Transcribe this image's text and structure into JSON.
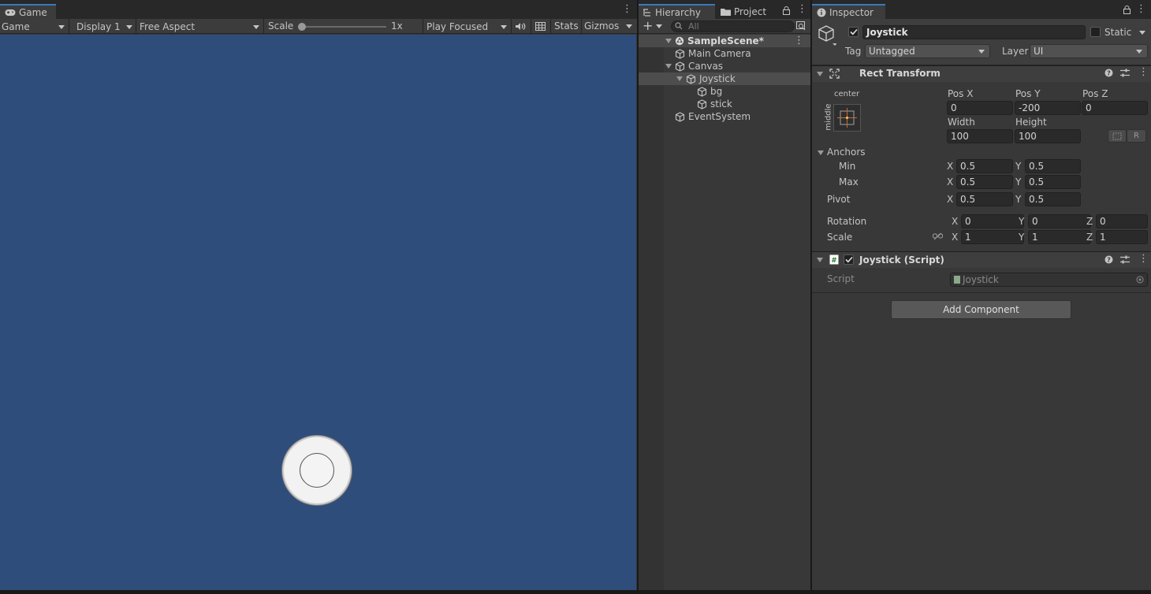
{
  "game": {
    "tab_label": "Game",
    "toolbar": {
      "mode": "Game",
      "display": "Display 1",
      "aspect": "Free Aspect",
      "scale_label": "Scale",
      "scale_value": "1x",
      "play_mode": "Play Focused",
      "stats": "Stats",
      "gizmos": "Gizmos"
    },
    "background_color": "#2f4d7a"
  },
  "hierarchy": {
    "tab_label": "Hierarchy",
    "project_tab_label": "Project",
    "search_placeholder": "All",
    "scene_name": "SampleScene*",
    "items": [
      {
        "label": "Main Camera",
        "depth": 1,
        "selected": false
      },
      {
        "label": "Canvas",
        "depth": 1,
        "selected": false
      },
      {
        "label": "Joystick",
        "depth": 2,
        "selected": true
      },
      {
        "label": "bg",
        "depth": 3,
        "selected": false
      },
      {
        "label": "stick",
        "depth": 3,
        "selected": false
      },
      {
        "label": "EventSystem",
        "depth": 1,
        "selected": false
      }
    ]
  },
  "inspector": {
    "tab_label": "Inspector",
    "object_name": "Joystick",
    "static_label": "Static",
    "tag_label": "Tag",
    "tag_value": "Untagged",
    "layer_label": "Layer",
    "layer_value": "UI",
    "rect_transform": {
      "title": "Rect Transform",
      "anchor_h": "center",
      "anchor_v": "middle",
      "posx_label": "Pos X",
      "posy_label": "Pos Y",
      "posz_label": "Pos Z",
      "posx": "0",
      "posy": "-200",
      "posz": "0",
      "width_label": "Width",
      "height_label": "Height",
      "width": "100",
      "height": "100",
      "r_button": "R",
      "anchors_label": "Anchors",
      "min_label": "Min",
      "max_label": "Max",
      "min_x": "0.5",
      "min_y": "0.5",
      "max_x": "0.5",
      "max_y": "0.5",
      "pivot_label": "Pivot",
      "pivot_x": "0.5",
      "pivot_y": "0.5",
      "rotation_label": "Rotation",
      "rot_x": "0",
      "rot_y": "0",
      "rot_z": "0",
      "scale_label": "Scale",
      "scale_x": "1",
      "scale_y": "1",
      "scale_z": "1",
      "x": "X",
      "y": "Y",
      "z": "Z"
    },
    "script_component": {
      "title": "Joystick (Script)",
      "script_label": "Script",
      "script_value": "Joystick"
    },
    "add_component": "Add Component"
  }
}
